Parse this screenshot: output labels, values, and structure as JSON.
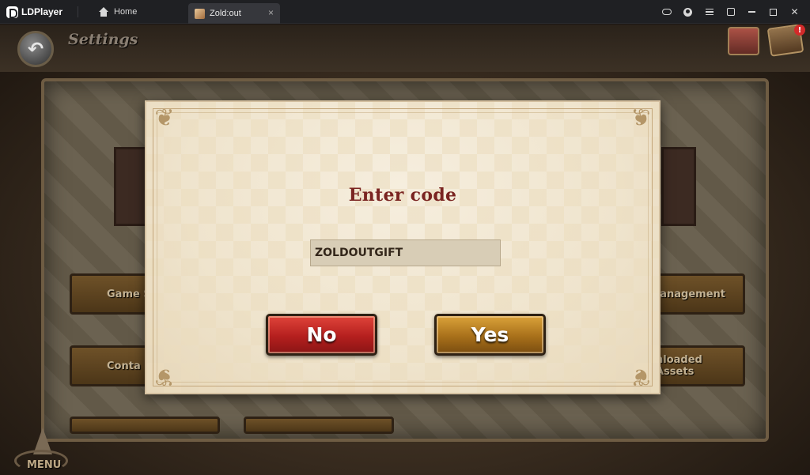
{
  "emulator": {
    "brand": "LDPlayer",
    "home_tab": "Home",
    "app_tab": "Zold:out",
    "app_tab_close": "×",
    "controls": [
      "gamepad-icon",
      "account-icon",
      "menu-icon",
      "popout-icon",
      "minimize-icon",
      "maximize-icon",
      "close-icon"
    ],
    "close_glyph": "✕"
  },
  "game": {
    "header_title": "Settings",
    "back_glyph": "↶",
    "notification_badge": "!",
    "menu_label": "MENU",
    "background_buttons": {
      "left_1": "Game S",
      "right_1": "Management",
      "left_2": "Conta",
      "right_2": "nloaded Assets"
    }
  },
  "dialog": {
    "title": "Enter code",
    "code_value": "ZOLDOUTGIFT",
    "no_label": "No",
    "yes_label": "Yes"
  },
  "colors": {
    "title_red": "#7a2421",
    "no_button": "#b41f1e",
    "yes_button": "#a8701a",
    "dialog_paper": "#efe4cd"
  }
}
